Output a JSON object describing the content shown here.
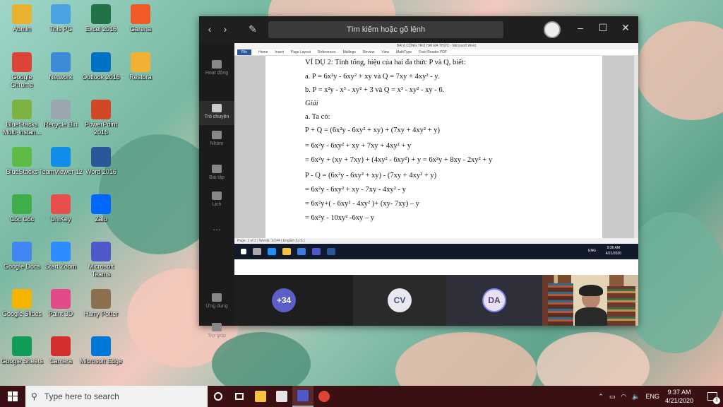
{
  "desktop_icons": [
    {
      "label": "Admin",
      "color": "#e8b130"
    },
    {
      "label": "This PC",
      "color": "#4aa3e0"
    },
    {
      "label": "Excel 2016",
      "color": "#217346"
    },
    {
      "label": "Garena",
      "color": "#f15a24"
    },
    {
      "label": "Google Chrome",
      "color": "#db4437"
    },
    {
      "label": "Network",
      "color": "#3d8bd8"
    },
    {
      "label": "Outlook 2016",
      "color": "#0072c6"
    },
    {
      "label": "Restora",
      "color": "#f2b035"
    },
    {
      "label": "BlueStacks Multi-Instan...",
      "color": "#7cb342"
    },
    {
      "label": "Recycle Bin",
      "color": "#9aa7b0"
    },
    {
      "label": "PowerPoint 2016",
      "color": "#d24726"
    },
    {
      "label": "BlueStacks",
      "color": "#5dbb46"
    },
    {
      "label": "TeamViewer 12",
      "color": "#0e8ee9"
    },
    {
      "label": "Word 2016",
      "color": "#2b579a"
    },
    {
      "label": "Cốc Cốc",
      "color": "#3fae49"
    },
    {
      "label": "UniKey",
      "color": "#e94e4e"
    },
    {
      "label": "Zalo",
      "color": "#0068ff"
    },
    {
      "label": "Google Docs",
      "color": "#4285f4"
    },
    {
      "label": "Start Zoom",
      "color": "#2d8cff"
    },
    {
      "label": "Microsoft Teams",
      "color": "#5059c9"
    },
    {
      "label": "Google Slides",
      "color": "#f4b400"
    },
    {
      "label": "Paint 3D",
      "color": "#e24a8a"
    },
    {
      "label": "Harry Potter",
      "color": "#8b6f4e"
    },
    {
      "label": "Google Sheets",
      "color": "#0f9d58"
    },
    {
      "label": "Camera",
      "color": "#d32f2f"
    },
    {
      "label": "Microsoft Edge",
      "color": "#0078d7"
    }
  ],
  "teams": {
    "search_placeholder": "Tìm kiếm hoặc gõ lệnh",
    "rail": [
      {
        "label": "Hoạt động",
        "active": false
      },
      {
        "label": "Trò chuyện",
        "active": true
      },
      {
        "label": "Nhóm",
        "active": false
      },
      {
        "label": "Bài tập",
        "active": false
      },
      {
        "label": "Lịch",
        "active": false
      },
      {
        "label": "...",
        "active": false
      },
      {
        "label": "Ứng dụng",
        "active": false
      },
      {
        "label": "Trợ giúp",
        "active": false
      }
    ],
    "participants": [
      {
        "label": "+34",
        "bg": "#5b5fc7",
        "fg": "#ffffff"
      },
      {
        "label": "CV",
        "bg": "#e8e8f0",
        "fg": "#4b4b7a"
      },
      {
        "label": "DA",
        "bg": "#e9e0f0",
        "fg": "#5a3f7a"
      }
    ]
  },
  "word": {
    "title": "BÀI 6 CỘNG TRỪ HAI ĐA THỨC - Microsoft Word",
    "ribbon": [
      "File",
      "Home",
      "Insert",
      "Page Layout",
      "References",
      "Mailings",
      "Review",
      "View",
      "MathType",
      "Foxit Reader PDF"
    ],
    "status": "Page: 1 of 2 | Words: 1/144 | English (U.S.)",
    "lines": [
      "VÍ DỤ 2: Tính tổng, hiệu của hai đa thức P và Q, biết:",
      "a. P = 6x²y - 6xy² + xy và Q = 7xy + 4xy² - y.",
      "b. P = x²y - x³ - xy² + 3 và Q = x³ - xy² - xy - 6.",
      "Giải",
      "a. Ta có:",
      "P + Q = (6x²y - 6xy² + xy) + (7xy + 4xy² + y)",
      "= 6x²y - 6xy² + xy + 7xy + 4xy² + y",
      "= 6x²y + (xy + 7xy) + (4xy² - 6xy²) + y = 6x²y + 8xy - 2xy² + y",
      "P - Q = (6x²y - 6xy² + xy) - (7xy + 4xy² + y)",
      "= 6x²y - 6xy² + xy - 7xy - 4xy² - y",
      "= 6x²y+( - 6xy² - 4xy² )+ (xy- 7xy) – y",
      "= 6x²y - 10xy² -6xy – y"
    ],
    "inner_clock_time": "9:36 AM",
    "inner_clock_date": "4/21/2020",
    "inner_lang": "ENG"
  },
  "taskbar": {
    "search_placeholder": "Type here to search",
    "lang": "ENG",
    "time": "9:37 AM",
    "date": "4/21/2020",
    "notification_count": "1"
  }
}
